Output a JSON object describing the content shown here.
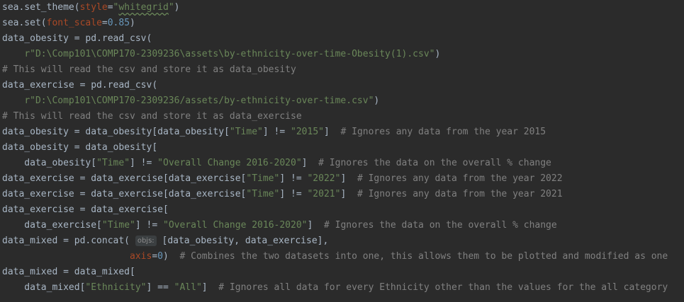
{
  "editor": {
    "colors": {
      "background": "#2b2b2b",
      "plain": "#a9b7c6",
      "keyword_argument": "#aa4926",
      "string": "#6a8759",
      "number": "#6897bb",
      "comment": "#808080",
      "inlay_hint_background": "#3b3f41"
    },
    "lines": [
      [
        [
          "sea.set_theme(",
          "plain"
        ],
        [
          "style",
          "kw"
        ],
        [
          "=",
          "plain"
        ],
        [
          "\"",
          "str"
        ],
        [
          "whitegrid",
          "str typo"
        ],
        [
          "\"",
          "str"
        ],
        [
          ")",
          "plain"
        ]
      ],
      [
        [
          "sea.set(",
          "plain"
        ],
        [
          "font_scale",
          "kw"
        ],
        [
          "=",
          "plain"
        ],
        [
          "0.85",
          "num"
        ],
        [
          ")",
          "plain"
        ]
      ],
      [
        [
          "data_obesity = pd.read_csv(",
          "plain"
        ]
      ],
      [
        [
          "    ",
          "plain"
        ],
        [
          "r\"D:\\Comp101\\COMP170-2309236\\assets\\by-ethnicity-over-time-Obesity(1).csv\"",
          "str"
        ],
        [
          ")",
          "plain"
        ]
      ],
      [
        [
          "# This will read the csv and store it as data_obesity",
          "com"
        ]
      ],
      [
        [
          "data_exercise = pd.read_csv(",
          "plain"
        ]
      ],
      [
        [
          "    ",
          "plain"
        ],
        [
          "r\"D:\\Comp101\\COMP170-2309236/assets/by-ethnicity-over-time.csv\"",
          "str"
        ],
        [
          ")",
          "plain"
        ]
      ],
      [
        [
          "# This will read the csv and store it as data_exercise",
          "com"
        ]
      ],
      [
        [
          "data_obesity = data_obesity[data_obesity[",
          "plain"
        ],
        [
          "\"Time\"",
          "str"
        ],
        [
          "] != ",
          "plain"
        ],
        [
          "\"2015\"",
          "str"
        ],
        [
          "]  ",
          "plain"
        ],
        [
          "# Ignores any data from the year 2015",
          "com"
        ]
      ],
      [
        [
          "data_obesity = data_obesity[",
          "plain"
        ]
      ],
      [
        [
          "    data_obesity[",
          "plain"
        ],
        [
          "\"Time\"",
          "str"
        ],
        [
          "] != ",
          "plain"
        ],
        [
          "\"Overall Change 2016-2020\"",
          "str"
        ],
        [
          "]  ",
          "plain"
        ],
        [
          "# Ignores the data on the overall % change",
          "com"
        ]
      ],
      [
        [
          "data_exercise = data_exercise[data_exercise[",
          "plain"
        ],
        [
          "\"Time\"",
          "str"
        ],
        [
          "] != ",
          "plain"
        ],
        [
          "\"2022\"",
          "str"
        ],
        [
          "]  ",
          "plain"
        ],
        [
          "# Ignores any data from the year 2022",
          "com"
        ]
      ],
      [
        [
          "data_exercise = data_exercise[data_exercise[",
          "plain"
        ],
        [
          "\"Time\"",
          "str"
        ],
        [
          "] != ",
          "plain"
        ],
        [
          "\"2021\"",
          "str"
        ],
        [
          "]  ",
          "plain"
        ],
        [
          "# Ignores any data from the year 2021",
          "com"
        ]
      ],
      [
        [
          "data_exercise = data_exercise[",
          "plain"
        ]
      ],
      [
        [
          "    data_exercise[",
          "plain"
        ],
        [
          "\"Time\"",
          "str"
        ],
        [
          "] != ",
          "plain"
        ],
        [
          "\"Overall Change 2016-2020\"",
          "str"
        ],
        [
          "]  ",
          "plain"
        ],
        [
          "# Ignores the data on the overall % change",
          "com"
        ]
      ],
      [
        [
          "data_mixed = pd.concat( ",
          "plain"
        ],
        [
          "objs:",
          "hint"
        ],
        [
          " [data_obesity, data_exercise],",
          "plain"
        ]
      ],
      [
        [
          "                       ",
          "plain"
        ],
        [
          "axis",
          "kw"
        ],
        [
          "=",
          "plain"
        ],
        [
          "0",
          "num"
        ],
        [
          ")  ",
          "plain"
        ],
        [
          "# Combines the two datasets into one, this allows them to be plotted and modified as one",
          "com"
        ]
      ],
      [
        [
          "data_mixed = data_mixed[",
          "plain"
        ]
      ],
      [
        [
          "    data_mixed[",
          "plain"
        ],
        [
          "\"Ethnicity\"",
          "str"
        ],
        [
          "] == ",
          "plain"
        ],
        [
          "\"All\"",
          "str"
        ],
        [
          "]  ",
          "plain"
        ],
        [
          "# Ignores all data for every Ethnicity other than the values for the all category",
          "com"
        ]
      ]
    ]
  }
}
